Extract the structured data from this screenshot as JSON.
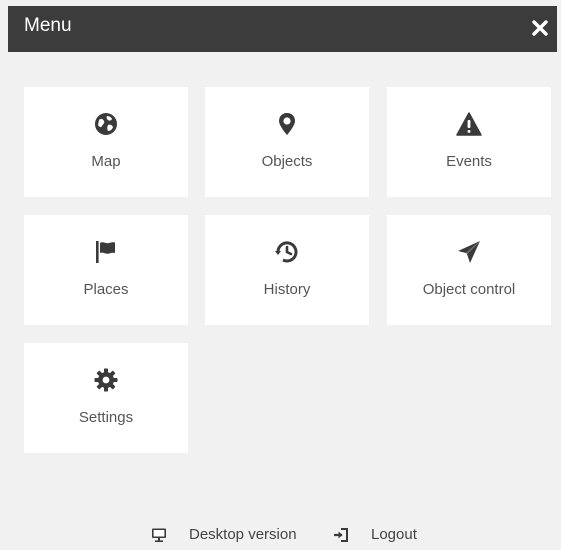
{
  "header": {
    "title": "Menu",
    "close_icon": "close-icon"
  },
  "tiles": [
    {
      "label": "Map",
      "icon": "globe-icon"
    },
    {
      "label": "Objects",
      "icon": "map-marker-icon"
    },
    {
      "label": "Events",
      "icon": "warning-icon"
    },
    {
      "label": "Places",
      "icon": "flag-icon"
    },
    {
      "label": "History",
      "icon": "history-icon"
    },
    {
      "label": "Object control",
      "icon": "paper-plane-icon"
    },
    {
      "label": "Settings",
      "icon": "gear-icon"
    }
  ],
  "footer": {
    "desktop_label": "Desktop version",
    "desktop_icon": "monitor-icon",
    "logout_label": "Logout",
    "logout_icon": "sign-out-icon"
  },
  "colors": {
    "background": "#f1f1f1",
    "header": "#3c3c3c",
    "tile": "#ffffff",
    "icon": "#3a3a3a",
    "text": "#555555"
  }
}
